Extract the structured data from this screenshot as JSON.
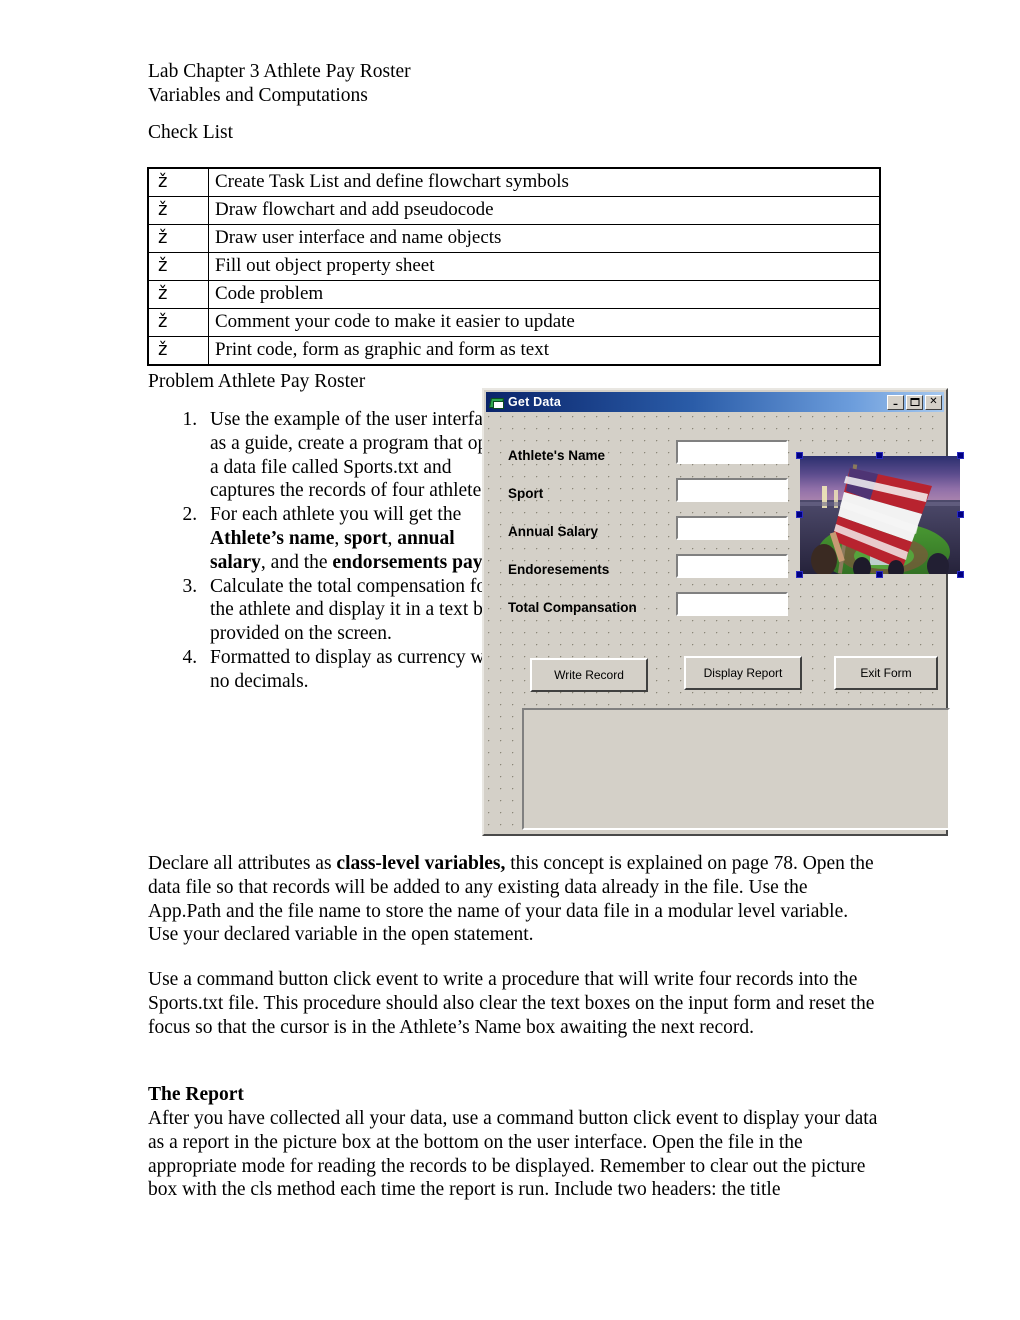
{
  "document": {
    "heading_lines": [
      "Lab Chapter 3 Athlete Pay Roster",
      "Variables and Computations"
    ],
    "checklist_title": "Check List",
    "checklist": {
      "mark": "ž",
      "items": [
        "Create Task List and define flowchart symbols",
        "Draw flowchart and add pseudocode",
        "Draw user interface and name objects",
        "Fill out object property sheet",
        "Code problem",
        "Comment your code to make it easier to update",
        "Print code, form as graphic and form as text"
      ]
    },
    "problem_title": "Problem  Athlete Pay Roster",
    "steps": [
      {
        "prefix": "Use the example of the user interface as a guide, create a program that opens a data file called Sports.txt and captures the records of four athletes.",
        "bold_parts": [],
        "suffix": ""
      },
      {
        "prefix": "For each athlete you will get the ",
        "bold_parts": [
          "Athlete’s name",
          "sport",
          "annual salary",
          "endorsements pay"
        ],
        "suffix": "."
      },
      {
        "prefix": "Calculate the total compensation for the athlete and display it in a text box provided on the screen.",
        "bold_parts": [],
        "suffix": ""
      },
      {
        "prefix": "Formatted to display as currency with no decimals.",
        "bold_parts": [],
        "suffix": ""
      }
    ],
    "step2_html": "For each athlete you will get the <b>Athlete’s name</b>, <b>sport</b>, <b>annual salary</b>, and the <b>endorsements pay</b>.",
    "paragraph_1_html": "Declare all attributes as <b>class-level variables,</b> this concept is explained on page 78.  Open the data file so that records will be added to any existing data already in the file.  Use the App.Path and the file name to store the name of your data file in a modular level variable.  Use your declared variable in the open statement.",
    "paragraph_2": "Use a command button click event to write a procedure that will write four records into the Sports.txt file.  This procedure should also clear the text boxes on the input form and reset the focus so that the cursor is in the Athlete’s Name box awaiting the next record.",
    "report_section_title": "The Report",
    "paragraph_3": "After you have collected all your data, use a command button click event to display your data as a report in the picture box at the bottom on the user interface.  Open the file in the appropriate mode for reading the records to be displayed.  Remember to clear out the picture box with the cls method each time the report is run.  Include two headers: the title"
  },
  "vb_form": {
    "title": "Get Data",
    "window_buttons": {
      "minimize": "–",
      "maximize": "",
      "close": "✕"
    },
    "labels": [
      "Athlete's Name",
      "Sport",
      "Annual Salary",
      "Endoresements",
      "Total Compansation"
    ],
    "textbox_values": [
      "",
      "",
      "",
      "",
      ""
    ],
    "buttons": [
      "Write Record",
      "Display Report",
      "Exit Form"
    ],
    "picture_box_content": "",
    "image_alt": "American flag waving over a baseball stadium at dusk",
    "colors": {
      "form_face": "#d4d0c8",
      "titlebar_start": "#0a246a",
      "titlebar_end": "#a6c8ee",
      "selection_handle": "#000080",
      "textbox_background": "#ffffff"
    }
  }
}
